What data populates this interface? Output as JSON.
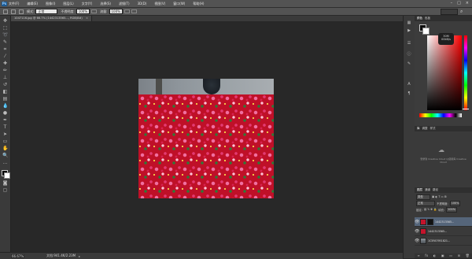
{
  "app": {
    "logo": "Ps"
  },
  "menu": [
    "文件(F)",
    "编辑(E)",
    "图像(I)",
    "图层(L)",
    "文字(Y)",
    "选择(S)",
    "滤镜(T)",
    "3D(D)",
    "视图(V)",
    "窗口(W)",
    "帮助(H)"
  ],
  "window_controls": [
    "–",
    "□",
    "×"
  ],
  "options": {
    "size_label": "正常",
    "mode_label": "模式:",
    "mode_value": "正常",
    "opacity_label": "不透明度:",
    "opacity_value": "100%",
    "flow_label": "流量:",
    "flow_value": "100%"
  },
  "document": {
    "tab_title": "1047116.jpg @ 66.7% (1442313565..., RGB/8#)",
    "close": "×"
  },
  "status": {
    "zoom": "66.67%",
    "doc_info": "文档:941.4K/2.23M",
    "arrow": "▸"
  },
  "color_panel": {
    "tabs": [
      "颜色",
      "色板"
    ],
    "cc_badge_line1": "30M",
    "cc_badge_line2": "00kB/s"
  },
  "libraries_panel": {
    "tabs": [
      "库",
      "调整",
      "样式"
    ],
    "text": "登录到 Creative Cloud 以使用库 Creative Cloud"
  },
  "layers_panel": {
    "tabs": [
      "图层",
      "通道",
      "路径"
    ],
    "filter_label": "类型",
    "blend_mode": "正常",
    "opacity_label": "不透明度:",
    "opacity_value": "100%",
    "lock_label": "锁定:",
    "fill_label": "填充:",
    "fill_value": "100%",
    "layers": [
      {
        "name": "1442313565...",
        "selected": true
      },
      {
        "name": "1442313565...",
        "selected": false
      },
      {
        "name": "1C5FA7951821...",
        "selected": false
      }
    ],
    "footer_icons": [
      "∞",
      "fx",
      "◐",
      "▣",
      "▭",
      "⊞",
      "🗑"
    ]
  }
}
